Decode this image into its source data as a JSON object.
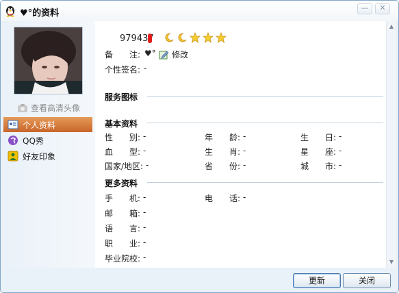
{
  "window": {
    "title": "♥°的资料"
  },
  "titlebar_buttons": {
    "minimize": "—",
    "close": "✕"
  },
  "sidebar": {
    "hd_link": "查看高清头像",
    "items": [
      {
        "label": "个人资料",
        "icon": "profile-card-icon"
      },
      {
        "label": "QQ秀",
        "icon": "qq-show-icon"
      },
      {
        "label": "好友印象",
        "icon": "friend-impression-icon"
      }
    ]
  },
  "profile": {
    "qq_number": "979437",
    "remark_label": "备　　注:",
    "remark_value": "♥°",
    "edit_label": "修改",
    "signature_label": "个性签名:",
    "signature_value": "-",
    "level_icons": [
      "moon",
      "moon",
      "star",
      "star",
      "star"
    ]
  },
  "sections": {
    "service_icons": "服务图标",
    "basic": "基本资料",
    "more": "更多资料"
  },
  "basic_fields": [
    {
      "label": "性　　别:",
      "value": "-"
    },
    {
      "label": "年　　龄:",
      "value": "-"
    },
    {
      "label": "生　　日:",
      "value": "-"
    },
    {
      "label": "血　　型:",
      "value": "-"
    },
    {
      "label": "生　　肖:",
      "value": "-"
    },
    {
      "label": "星　　座:",
      "value": "-"
    },
    {
      "label": "国家/地区:",
      "value": "-"
    },
    {
      "label": "省　　份:",
      "value": "-"
    },
    {
      "label": "城　　市:",
      "value": "-"
    }
  ],
  "more_fields": [
    {
      "label": "手　　机:",
      "value": "-"
    },
    {
      "label": "电　　话:",
      "value": "-"
    },
    {
      "label": "邮　　箱:",
      "value": "-"
    },
    {
      "label": "语　　言:",
      "value": "-"
    },
    {
      "label": "职　　业:",
      "value": "-"
    },
    {
      "label": "毕业院校:",
      "value": "-"
    }
  ],
  "footer": {
    "refresh": "更新",
    "close": "关闭"
  },
  "colors": {
    "accent": "#d8783b",
    "frame": "#7fa6c8",
    "rule": "#bfd0e0"
  }
}
